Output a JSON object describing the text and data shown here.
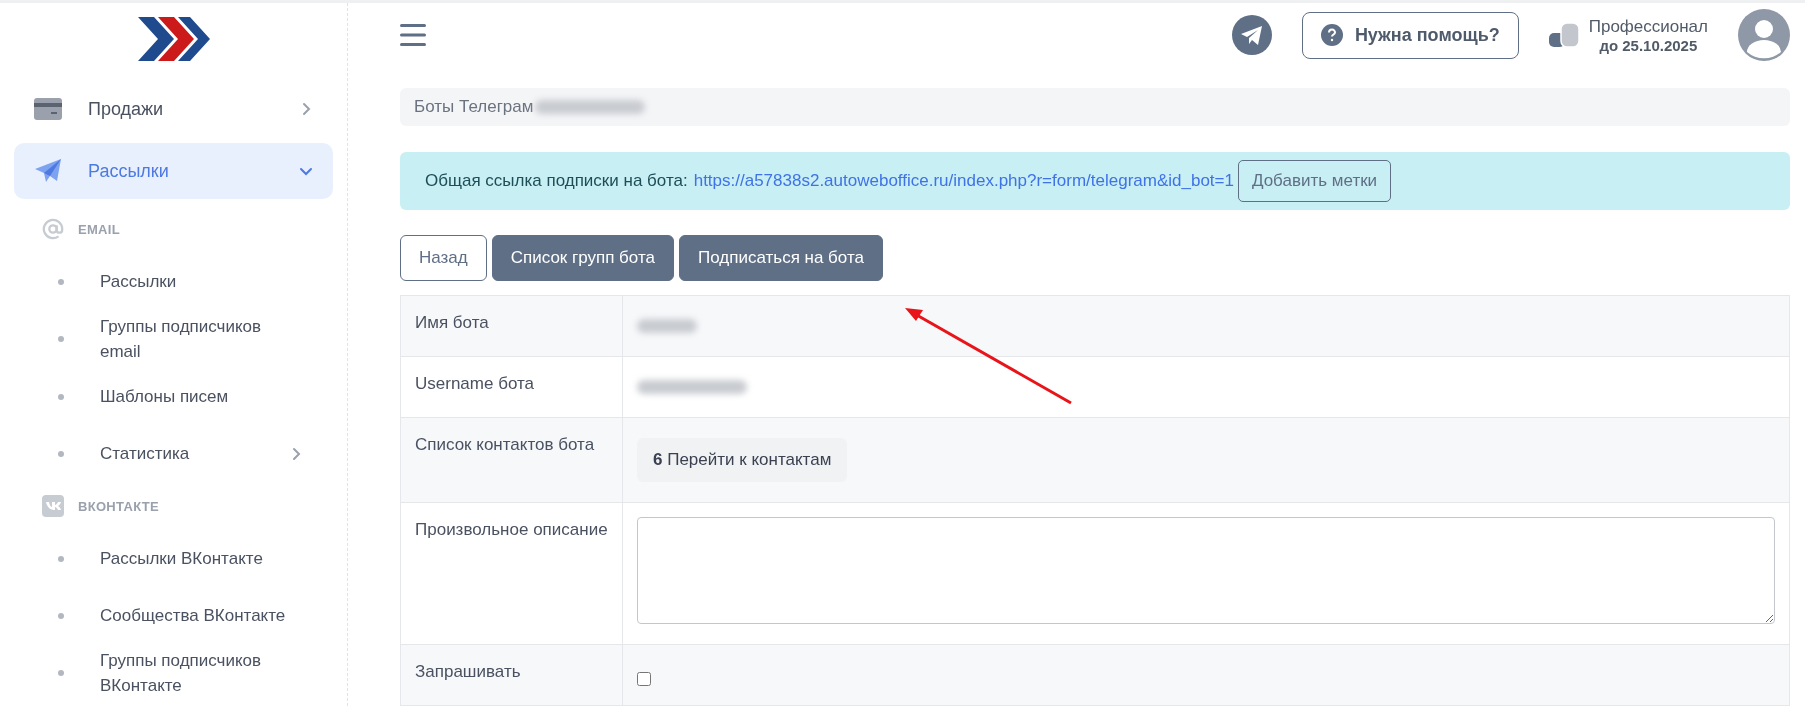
{
  "sidebar": {
    "items": [
      {
        "kind": "menu",
        "label": "Продажи",
        "expanded": false,
        "selected": false
      },
      {
        "kind": "menu",
        "label": "Рассылки",
        "expanded": true,
        "selected": true
      },
      {
        "kind": "section",
        "label": "EMAIL"
      },
      {
        "kind": "subitem",
        "label": "Рассылки",
        "expandable": false
      },
      {
        "kind": "subitem",
        "label": "Группы подписчиков email",
        "expandable": false
      },
      {
        "kind": "subitem",
        "label": "Шаблоны писем",
        "expandable": false
      },
      {
        "kind": "subitem",
        "label": "Статистика",
        "expandable": true
      },
      {
        "kind": "section",
        "label": "ВКОНТАКТЕ"
      },
      {
        "kind": "subitem",
        "label": "Рассылки ВКонтакте",
        "expandable": false
      },
      {
        "kind": "subitem",
        "label": "Сообщества ВКонтакте",
        "expandable": false
      },
      {
        "kind": "subitem",
        "label": "Группы подписчиков ВКонтакте",
        "expandable": false
      }
    ]
  },
  "header": {
    "help_button": "Нужна помощь?",
    "plan": {
      "name": "Профессионал",
      "expires": "до 25.10.2025"
    }
  },
  "breadcrumb": "Боты Телеграм",
  "alert": {
    "text": "Общая ссылка подписки на бота:",
    "link": "https://a57838s2.autoweboffice.ru/index.php?r=form/telegram&id_bot=1",
    "button": "Добавить метки"
  },
  "actions": [
    {
      "label": "Назад",
      "kind": "outline"
    },
    {
      "label": "Список групп бота",
      "kind": "solid"
    },
    {
      "label": "Подписаться на бота",
      "kind": "solid"
    }
  ],
  "form_rows": [
    {
      "label": "Имя бота",
      "kind": "redacted"
    },
    {
      "label": "Username бота",
      "kind": "redacted"
    },
    {
      "label": "Список контактов бота",
      "kind": "link",
      "value": "**6** Перейти к контактам"
    },
    {
      "label": "Произвольное описание",
      "kind": "textarea"
    },
    {
      "label": "Запрашивать",
      "kind": "checkbox",
      "checked": false
    }
  ]
}
